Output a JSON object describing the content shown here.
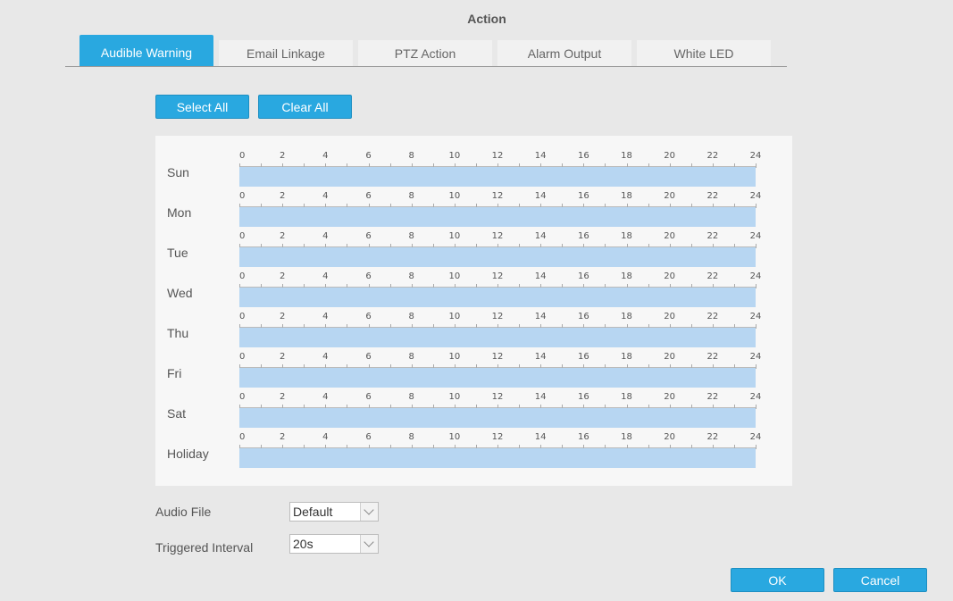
{
  "dialog": {
    "title": "Action"
  },
  "tabs": [
    {
      "label": "Audible Warning",
      "active": true
    },
    {
      "label": "Email Linkage",
      "active": false
    },
    {
      "label": "PTZ Action",
      "active": false
    },
    {
      "label": "Alarm Output",
      "active": false
    },
    {
      "label": "White LED",
      "active": false
    }
  ],
  "toolbar": {
    "select_all_label": "Select All",
    "clear_all_label": "Clear All"
  },
  "schedule": {
    "hour_labels": [
      "0",
      "2",
      "4",
      "6",
      "8",
      "10",
      "12",
      "14",
      "16",
      "18",
      "20",
      "22",
      "24"
    ],
    "days": [
      "Sun",
      "Mon",
      "Tue",
      "Wed",
      "Thu",
      "Fri",
      "Sat",
      "Holiday"
    ],
    "bar_color": "#b7d6f2"
  },
  "form": {
    "audio_file_label": "Audio File",
    "audio_file_value": "Default",
    "triggered_interval_label": "Triggered Interval",
    "triggered_interval_value": "20s"
  },
  "footer": {
    "ok_label": "OK",
    "cancel_label": "Cancel"
  },
  "colors": {
    "accent": "#29a8e0",
    "background": "#e8e8e8",
    "panel": "#f7f7f7"
  }
}
